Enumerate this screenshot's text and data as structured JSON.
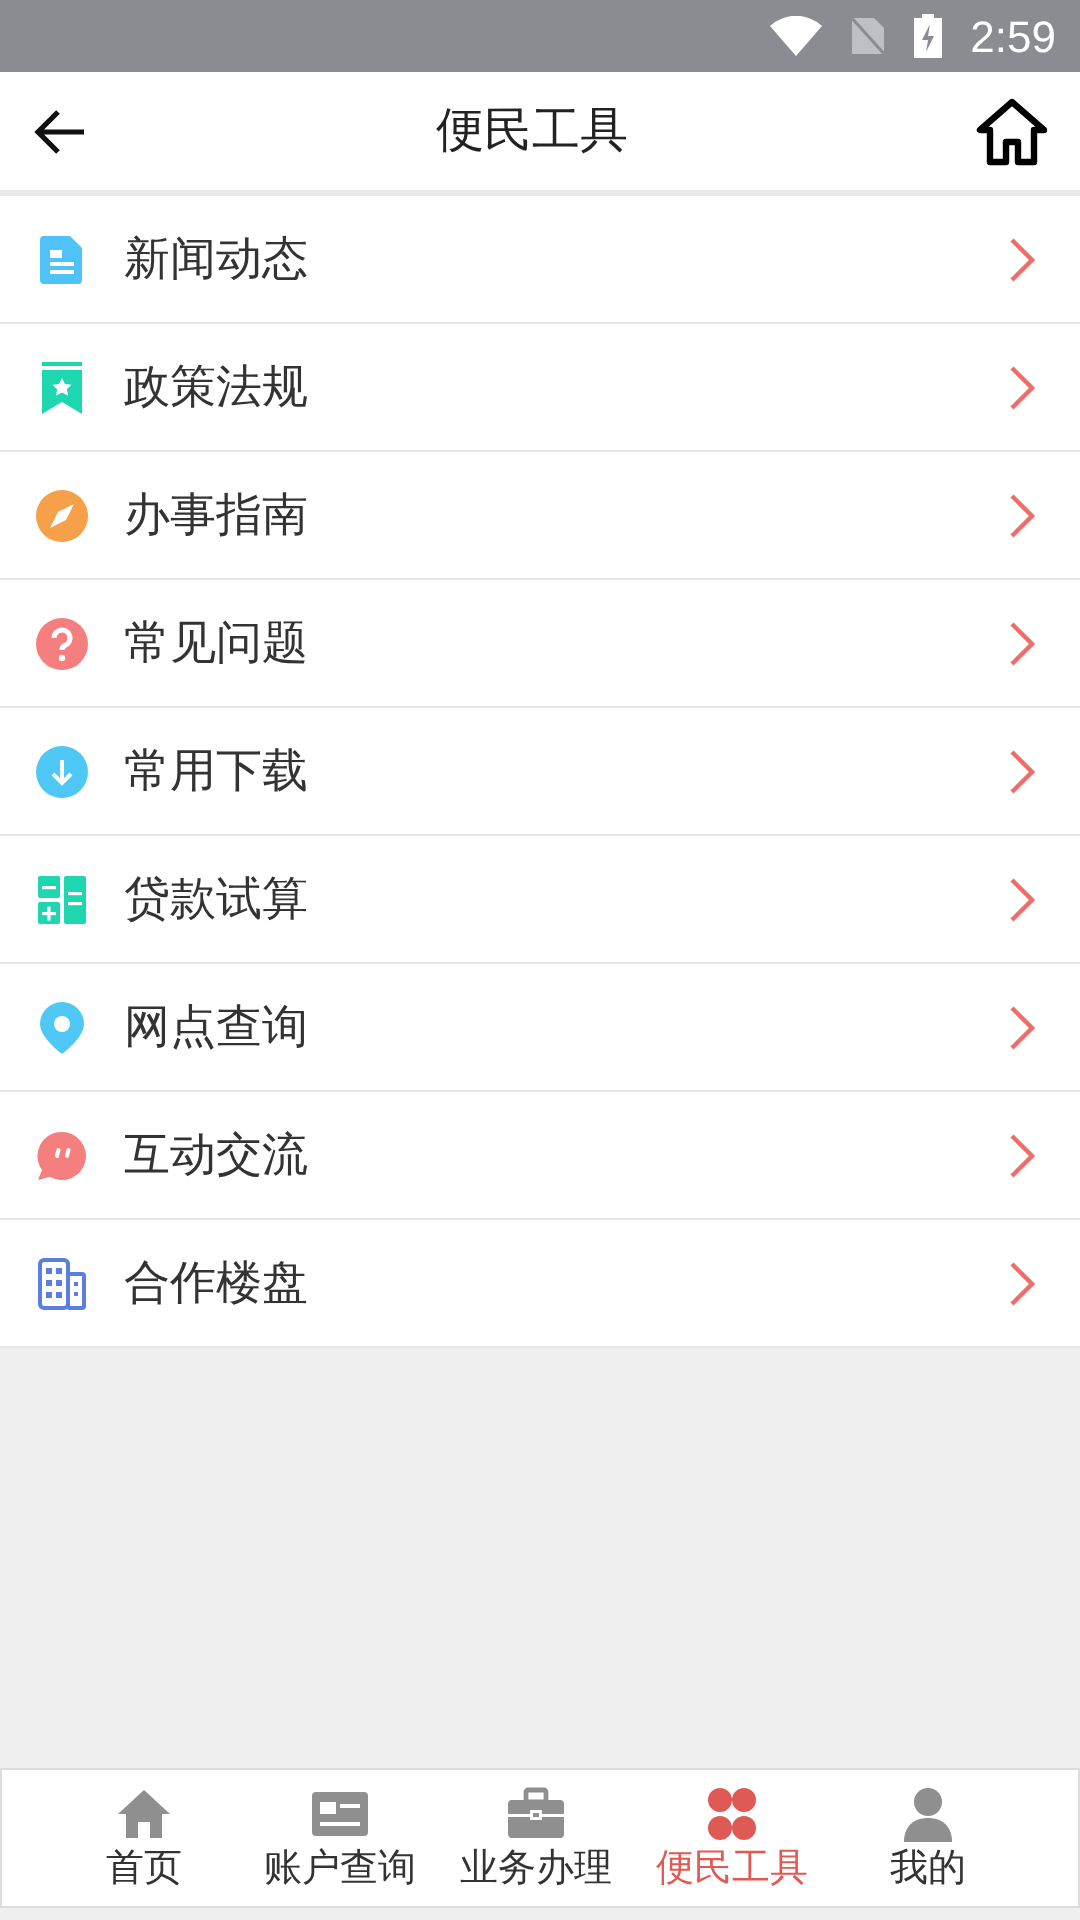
{
  "status_bar": {
    "time": "2:59"
  },
  "header": {
    "title": "便民工具"
  },
  "menu": [
    {
      "label": "新闻动态",
      "kind": "document"
    },
    {
      "label": "政策法规",
      "kind": "bookmark"
    },
    {
      "label": "办事指南",
      "kind": "compass"
    },
    {
      "label": "常见问题",
      "kind": "question"
    },
    {
      "label": "常用下载",
      "kind": "download"
    },
    {
      "label": "贷款试算",
      "kind": "calculator"
    },
    {
      "label": "网点查询",
      "kind": "pin"
    },
    {
      "label": "互动交流",
      "kind": "chat"
    },
    {
      "label": "合作楼盘",
      "kind": "building"
    }
  ],
  "tab_bar": [
    {
      "label": "首页",
      "kind": "home",
      "selected": false
    },
    {
      "label": "账户查询",
      "kind": "card",
      "selected": false
    },
    {
      "label": "业务办理",
      "kind": "briefcase",
      "selected": false
    },
    {
      "label": "便民工具",
      "kind": "tools",
      "selected": true
    },
    {
      "label": "我的",
      "kind": "person",
      "selected": false
    }
  ]
}
